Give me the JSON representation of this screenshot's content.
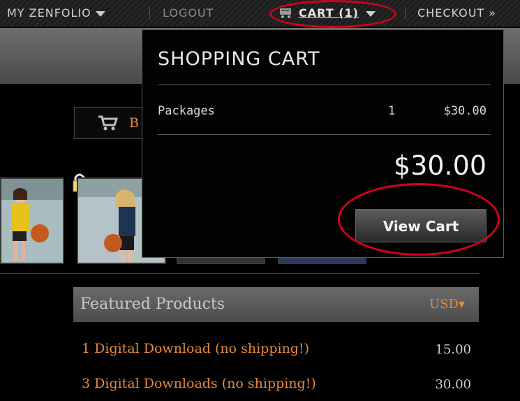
{
  "topbar": {
    "my_zenfolio": "MY ZENFOLIO",
    "logout": "LOGOUT",
    "cart": "CART (1)",
    "checkout": "CHECKOUT",
    "checkout_arrow": "»"
  },
  "buy_button": {
    "label": "B"
  },
  "cart_dropdown": {
    "title": "SHOPPING CART",
    "rows": [
      {
        "item": "Packages",
        "qty": "1",
        "price": "$30.00"
      }
    ],
    "total": "$30.00",
    "view_cart_label": "View Cart"
  },
  "featured": {
    "heading": "Featured Products",
    "currency": "USD▾",
    "products": [
      {
        "name": "1 Digital Download (no shipping!)",
        "price": "15.00"
      },
      {
        "name": "3 Digital Downloads (no shipping!)",
        "price": "30.00"
      }
    ]
  },
  "colors": {
    "accent_orange": "#e88a3a",
    "highlight_red": "#d6001c",
    "background": "#000000"
  },
  "icons": [
    "cart-icon",
    "chevron-down-icon",
    "lock-icon"
  ]
}
